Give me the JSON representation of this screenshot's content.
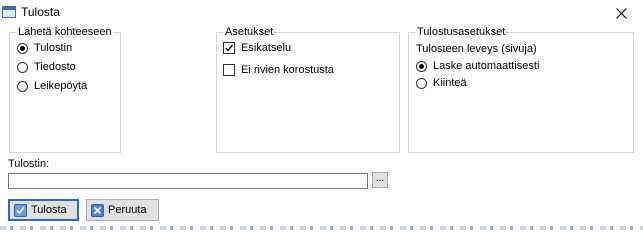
{
  "window": {
    "title": "Tulosta"
  },
  "destination": {
    "label": "Lähetä kohteeseen",
    "options": [
      {
        "label": "Tulostin",
        "selected": true
      },
      {
        "label": "Tiedosto",
        "selected": false
      },
      {
        "label": "Leikepöytä",
        "selected": false
      }
    ]
  },
  "settings": {
    "label": "Asetukset",
    "options": [
      {
        "label": "Esikatselu",
        "checked": true
      },
      {
        "label": "Ei rivien korostusta",
        "checked": false
      }
    ]
  },
  "print_settings": {
    "label": "Tulostusasetukset",
    "width_label": "Tulosteen leveys (sivuja)",
    "options": [
      {
        "label": "Laske automaattisesti",
        "selected": true
      },
      {
        "label": "Kiinteä",
        "selected": false
      }
    ]
  },
  "printer": {
    "label": "Tulostin:",
    "value": "",
    "browse_label": "..."
  },
  "buttons": {
    "print_label": "Tulosta",
    "cancel_label": "Peruuta"
  },
  "colors": {
    "accent": "#2a6cc4",
    "group_border": "#d4d4d4",
    "button_face": "#e1e1e1"
  }
}
